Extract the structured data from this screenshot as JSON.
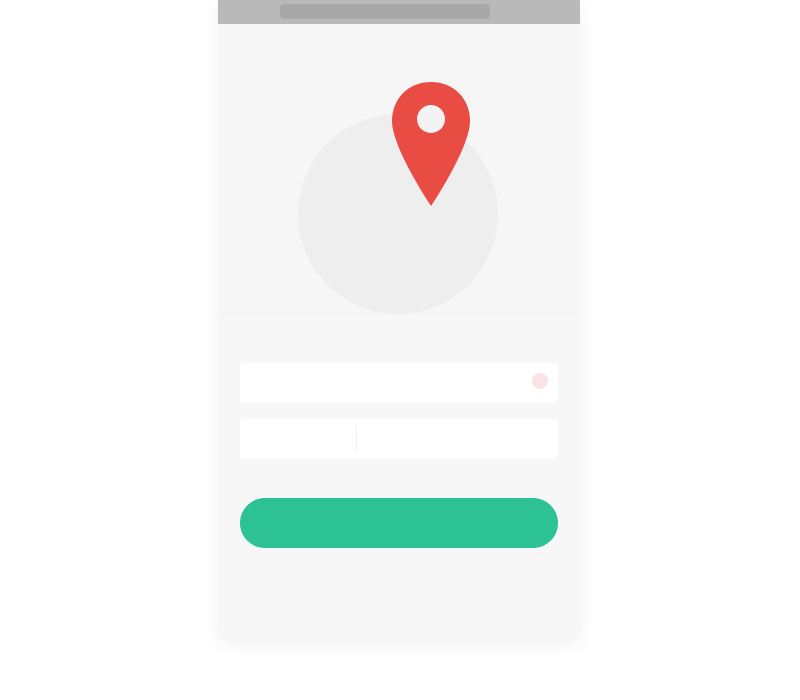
{
  "status_bar": {
    "time": "",
    "icons": ""
  },
  "hero": {
    "pin_icon": "location-pin-icon",
    "pin_color": "#e94c43",
    "circle_color": "#eeeeee"
  },
  "form": {
    "heading": "",
    "field_one": {
      "placeholder": "",
      "required_mark": ""
    },
    "field_two": {
      "left_text": "",
      "right_text": ""
    },
    "submit_label": ""
  },
  "colors": {
    "accent": "#2cc294",
    "pin": "#e94c43",
    "background": "#f7f7f7"
  }
}
